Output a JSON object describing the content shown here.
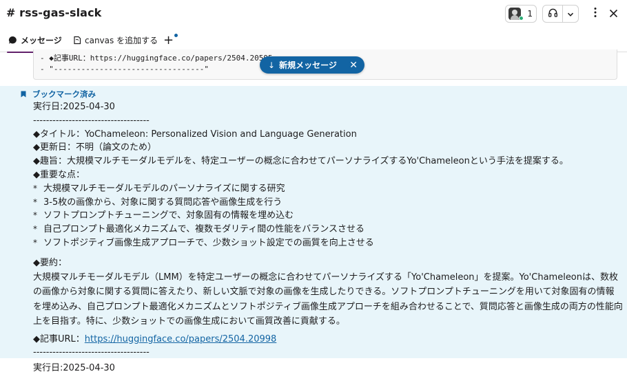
{
  "header": {
    "channel_name": "# rss-gas-slack",
    "member_count": "1"
  },
  "tabs": {
    "messages": "メッセージ",
    "canvas": "canvas を追加する",
    "add": "+"
  },
  "code_block": {
    "line1": "- ◆記事URL：https://huggingface.co/papers/2504.20595",
    "line2": "- \"---------------------------------\""
  },
  "new_message_pill": {
    "label": "新規メッセージ"
  },
  "message": {
    "bookmark_label": "ブックマーク済み",
    "date": "実行日:2025-04-30",
    "divider": "------------------------------------",
    "title": "◆タイトル：YoChameleon: Personalized Vision and Language Generation",
    "updated": "◆更新日：不明（論文のため）",
    "gist": "◆趣旨：大規模マルチモーダルモデルを、特定ユーザーの概念に合わせてパーソナライズするYo'Chameleonという手法を提案する。",
    "key_points_heading": "◆重要な点：",
    "key_points": [
      "大規模マルチモーダルモデルのパーソナライズに関する研究",
      "3-5枚の画像から、対象に関する質問応答や画像生成を行う",
      "ソフトプロンプトチューニングで、対象固有の情報を埋め込む",
      "自己プロンプト最適化メカニズムで、複数モダリティ間の性能をバランスさせる",
      "ソフトポジティブ画像生成アプローチで、少数ショット設定での画質を向上させる"
    ],
    "summary_heading": "◆要約：",
    "summary": "大規模マルチモーダルモデル（LMM）を特定ユーザーの概念に合わせてパーソナライズする「Yo'Chameleon」を提案。Yo'Chameleonは、数枚の画像から対象に関する質問に答えたり、新しい文脈で対象の画像を生成したりできる。ソフトプロンプトチューニングを用いて対象固有の情報を埋め込み、自己プロンプト最適化メカニズムとソフトポジティブ画像生成アプローチを組み合わせることで、質問応答と画像生成の両方の性能向上を目指す。特に、少数ショットでの画像生成において画質改善に貢献する。",
    "url_label": "◆記事URL：",
    "url": "https://huggingface.co/papers/2504.20998",
    "divider_end": "------------------------------------"
  },
  "next_message": {
    "date": "実行日:2025-04-30"
  },
  "colors": {
    "accent": "#611f69",
    "link": "#1264a3",
    "highlight_bg": "#e8f5fa",
    "online": "#2bac76"
  },
  "icons": [
    "member-avatar",
    "headphones-icon",
    "chevron-down-icon",
    "kebab-icon",
    "close-icon",
    "speech-bubble-icon",
    "canvas-icon",
    "plus-icon",
    "arrow-down-icon",
    "bookmark-icon"
  ]
}
